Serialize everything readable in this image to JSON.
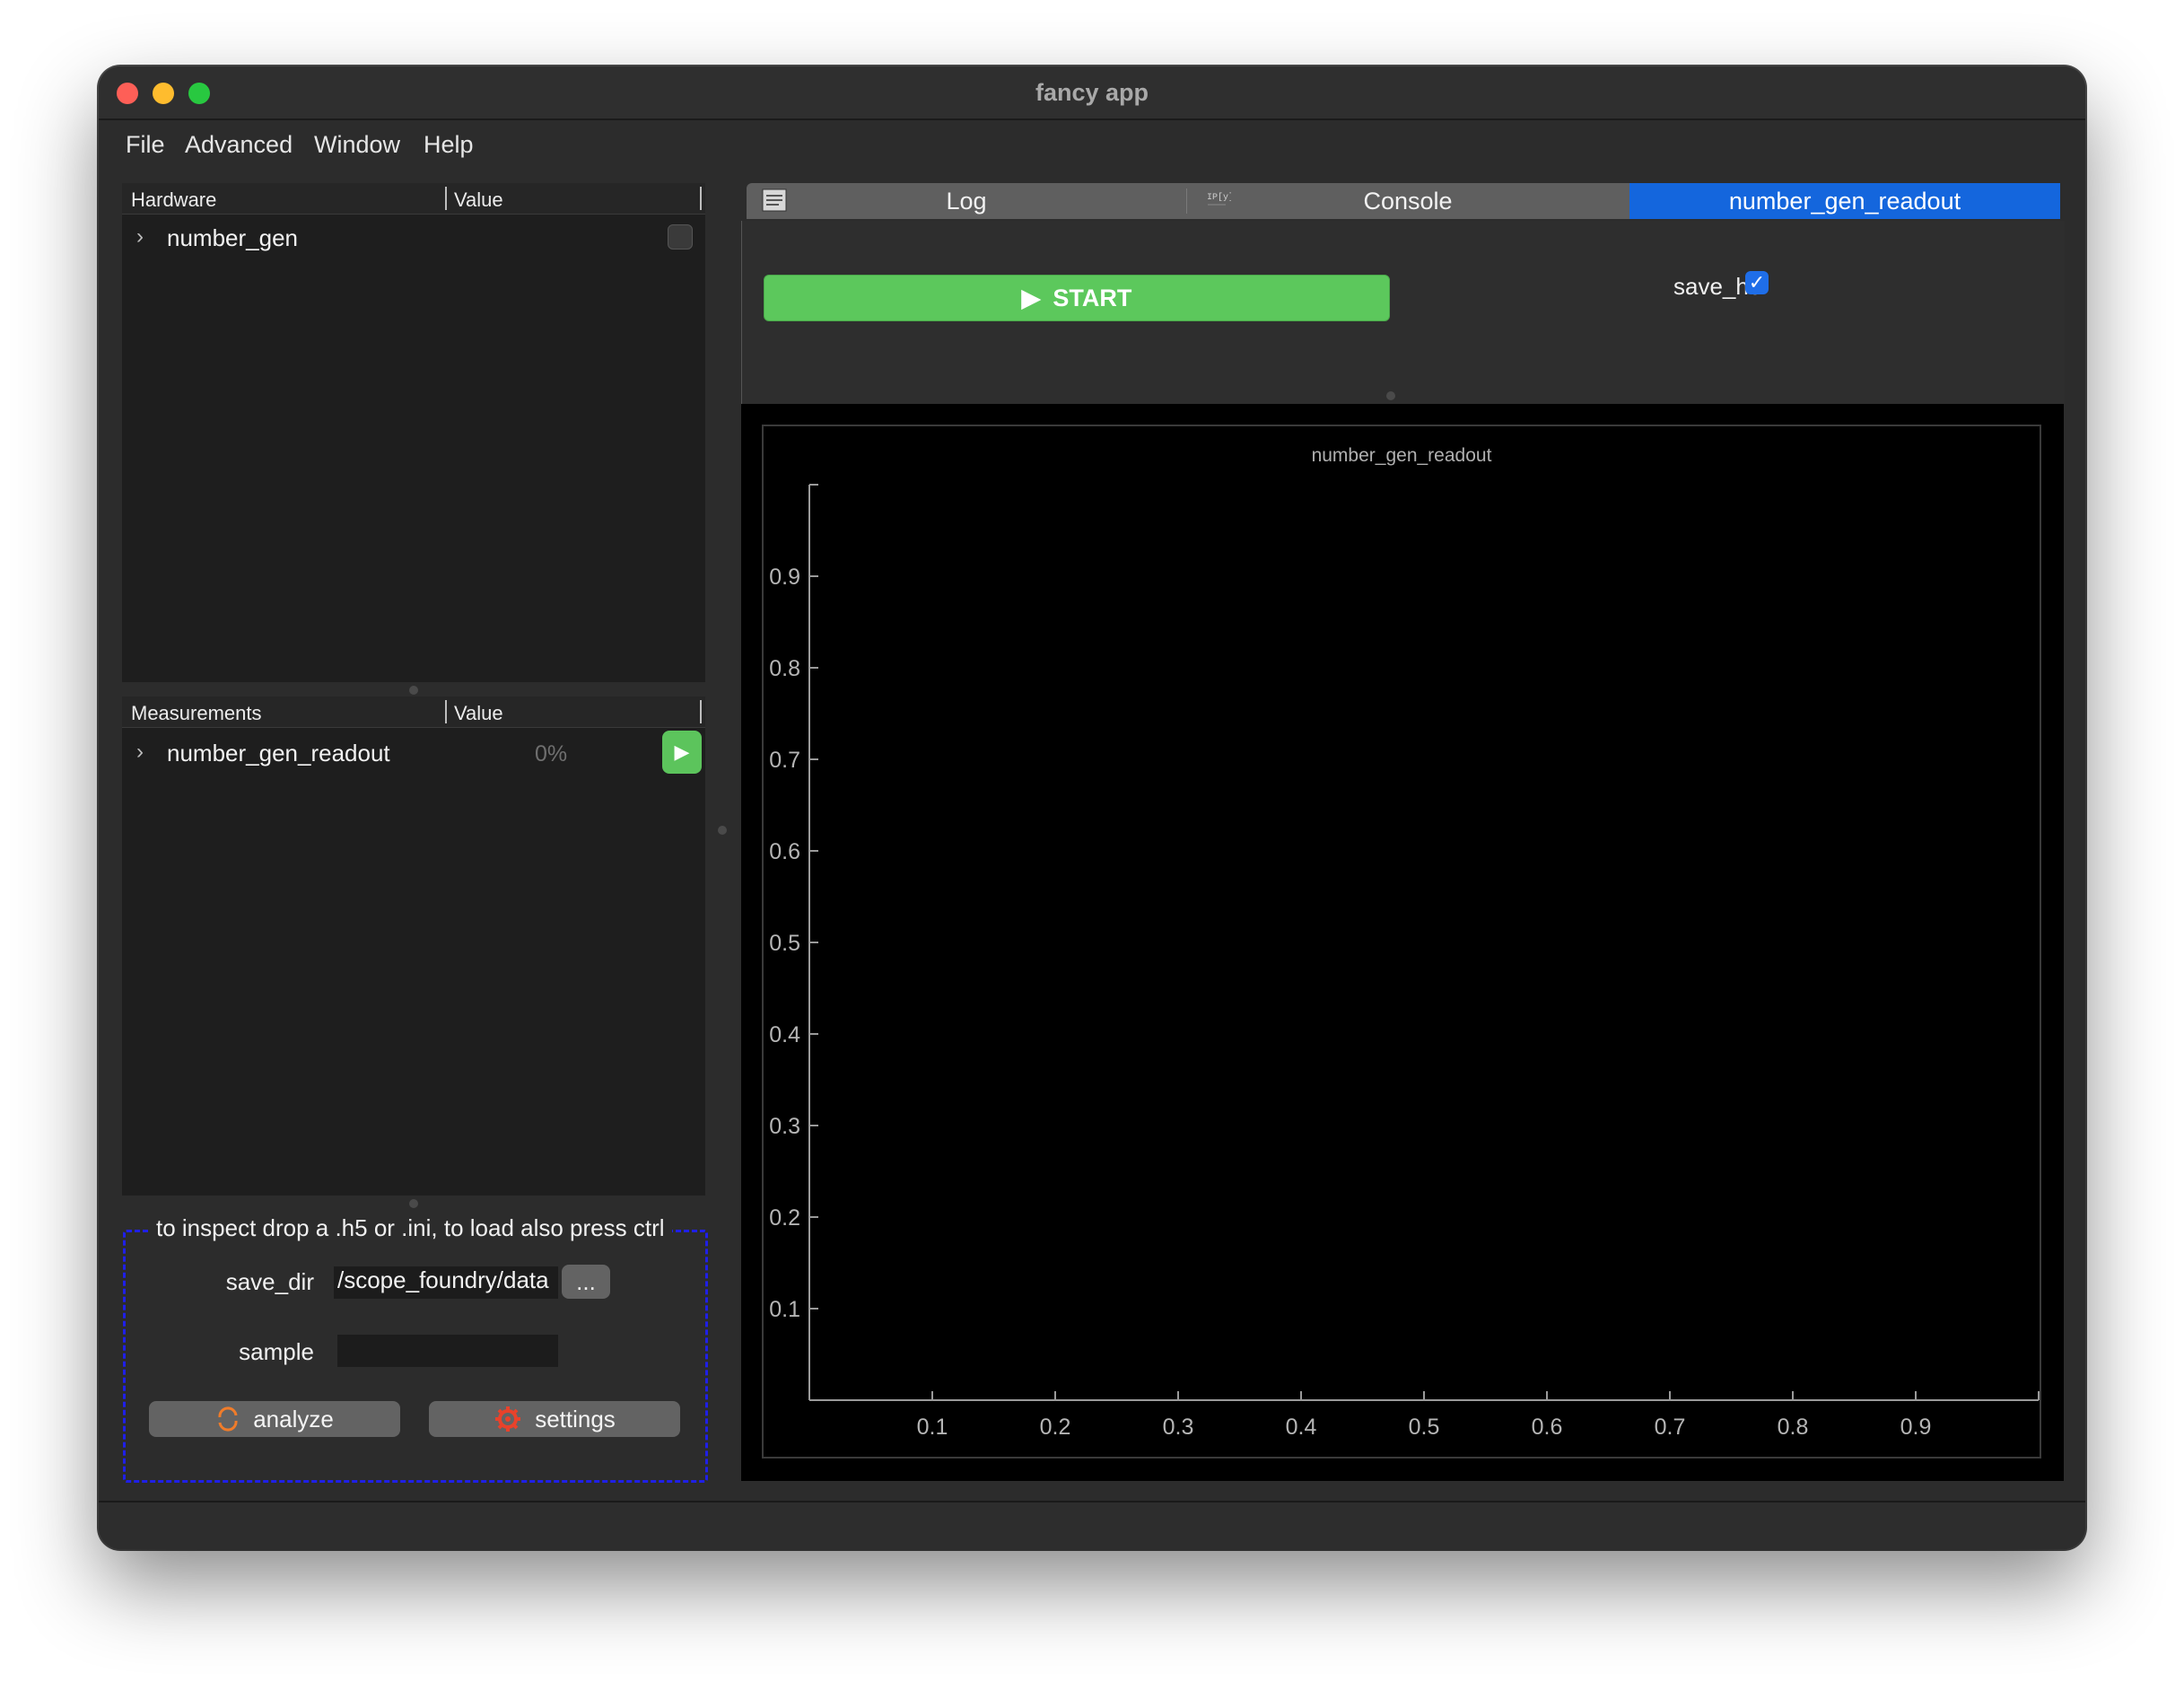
{
  "window": {
    "title": "fancy app"
  },
  "menu": [
    "File",
    "Advanced",
    "Window",
    "Help"
  ],
  "hardware_panel": {
    "col1": "Hardware",
    "col2": "Value",
    "items": [
      {
        "label": "number_gen",
        "checked": false
      }
    ]
  },
  "measurements_panel": {
    "col1": "Measurements",
    "col2": "Value",
    "items": [
      {
        "label": "number_gen_readout",
        "progress_text": "0%"
      }
    ]
  },
  "dropzone": {
    "legend": "to inspect drop a .h5 or .ini, to load also press ctrl",
    "save_dir_label": "save_dir",
    "save_dir_value": "/scope_foundry/data",
    "browse_label": "...",
    "sample_label": "sample",
    "sample_value": "",
    "analyze_label": "analyze",
    "settings_label": "settings"
  },
  "tabs": [
    {
      "label": "Log",
      "icon": "log-icon",
      "active": false
    },
    {
      "label": "Console",
      "icon": "ipython-icon",
      "active": false
    },
    {
      "label": "number_gen_readout",
      "icon": "",
      "active": true
    }
  ],
  "controls": {
    "start_label": "START",
    "save_h5_label": "save_h5",
    "save_h5_checked": true
  },
  "colors": {
    "accent_blue": "#1466dd",
    "start_green": "#5cc85c",
    "dropzone_border": "#1f1fe8",
    "background": "#2c2c2c",
    "plot_background": "#000000"
  },
  "chart_data": {
    "type": "line",
    "title": "number_gen_readout",
    "xlabel": "",
    "ylabel": "",
    "xlim": [
      0,
      1
    ],
    "ylim": [
      0,
      1
    ],
    "xticks": [
      "0.1",
      "0.2",
      "0.3",
      "0.4",
      "0.5",
      "0.6",
      "0.7",
      "0.8",
      "0.9"
    ],
    "yticks": [
      "0.1",
      "0.2",
      "0.3",
      "0.4",
      "0.5",
      "0.6",
      "0.7",
      "0.8",
      "0.9"
    ],
    "series": [],
    "grid": false
  }
}
